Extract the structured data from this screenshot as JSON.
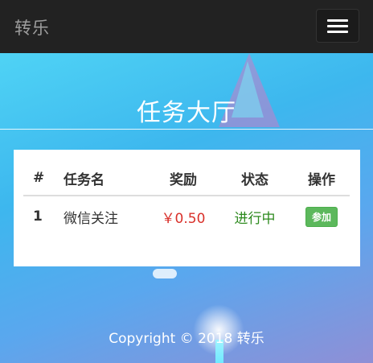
{
  "navbar": {
    "brand": "转乐",
    "toggle_icon": "hamburger-menu-icon"
  },
  "page": {
    "title": "任务大厅"
  },
  "table": {
    "headers": [
      "#",
      "任务名",
      "奖励",
      "状态",
      "操作"
    ],
    "rows": [
      {
        "num": "1",
        "name": "微信关注",
        "reward": "￥0.50",
        "status": "进行中",
        "action": "参加"
      }
    ]
  },
  "footer": {
    "copyright": "Copyright © 2018 转乐"
  },
  "colors": {
    "navbar_bg": "#222222",
    "reward": "#d9302a",
    "status": "#2d8a1e",
    "join_button": "#5cb85c"
  }
}
